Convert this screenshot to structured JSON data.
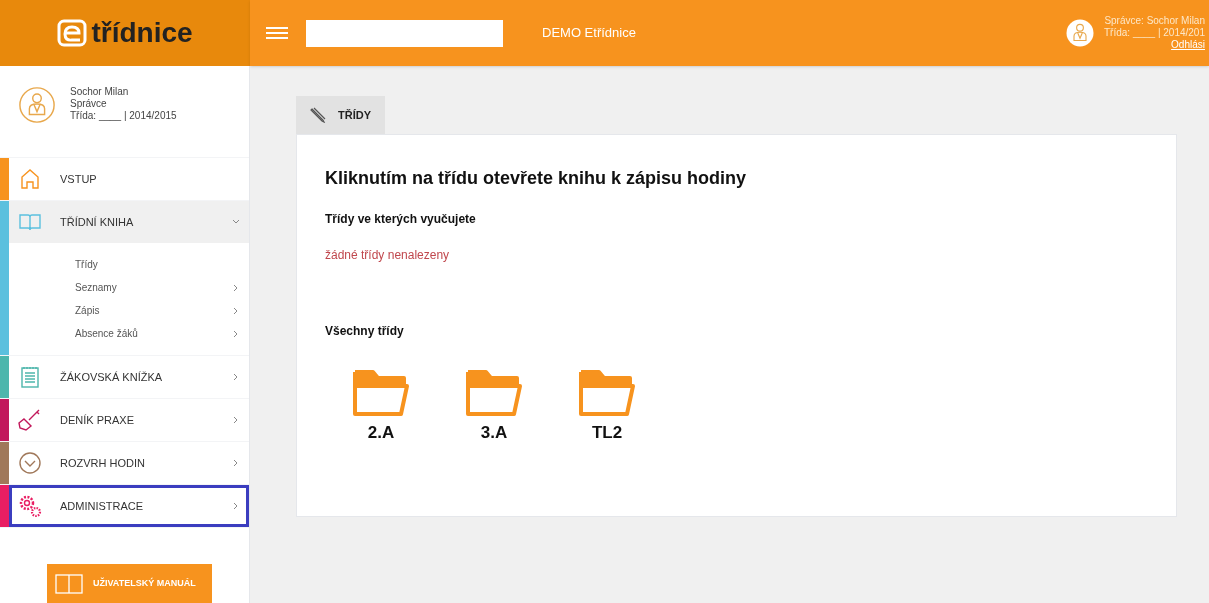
{
  "logo": {
    "text": "třídnice"
  },
  "header": {
    "title": "DEMO Etřídnice",
    "user_lines": [
      "Správce: Sochor Milan",
      "Třída: ____ | 2014/201"
    ],
    "logout": "Odhlási"
  },
  "profile": {
    "name": "Sochor Milan",
    "role": "Správce",
    "class_line": "Třída: ____ | 2014/2015"
  },
  "menu": [
    {
      "kind": "home",
      "label": "VSTUP",
      "color": "#f7931e",
      "selected": false,
      "expanded": false,
      "has_arrow": false
    },
    {
      "kind": "book",
      "label": "TŘÍDNÍ KNIHA",
      "color": "#5bc0de",
      "selected": false,
      "expanded": true,
      "has_arrow": true,
      "children": [
        {
          "label": "Třídy",
          "has_arrow": false
        },
        {
          "label": "Seznamy",
          "has_arrow": true
        },
        {
          "label": "Zápis",
          "has_arrow": true
        },
        {
          "label": "Absence žáků",
          "has_arrow": true
        }
      ]
    },
    {
      "kind": "notebook",
      "label": "ŽÁKOVSKÁ KNÍŽKA",
      "color": "#4db6ac",
      "selected": false,
      "expanded": false,
      "has_arrow": true
    },
    {
      "kind": "shovel",
      "label": "DENÍK PRAXE",
      "color": "#c2185b",
      "selected": false,
      "expanded": false,
      "has_arrow": true
    },
    {
      "kind": "clock",
      "label": "ROZVRH HODIN",
      "color": "#a0785a",
      "selected": false,
      "expanded": false,
      "has_arrow": true
    },
    {
      "kind": "gears",
      "label": "ADMINISTRACE",
      "color": "#e91e63",
      "selected": true,
      "expanded": false,
      "has_arrow": true
    }
  ],
  "manual_button": "UŽIVATELSKÝ MANUÁL",
  "tab": {
    "label": "TŘÍDY",
    "selected": true
  },
  "content": {
    "heading": "Kliknutím na třídu otevřete knihu k zápisu hodiny",
    "teaching_title": "Třídy ve kterých vyučujete",
    "teaching_empty": "žádné třídy nenalezeny",
    "all_title": "Všechny třídy",
    "classes": [
      "2.A",
      "3.A",
      "TL2"
    ]
  }
}
